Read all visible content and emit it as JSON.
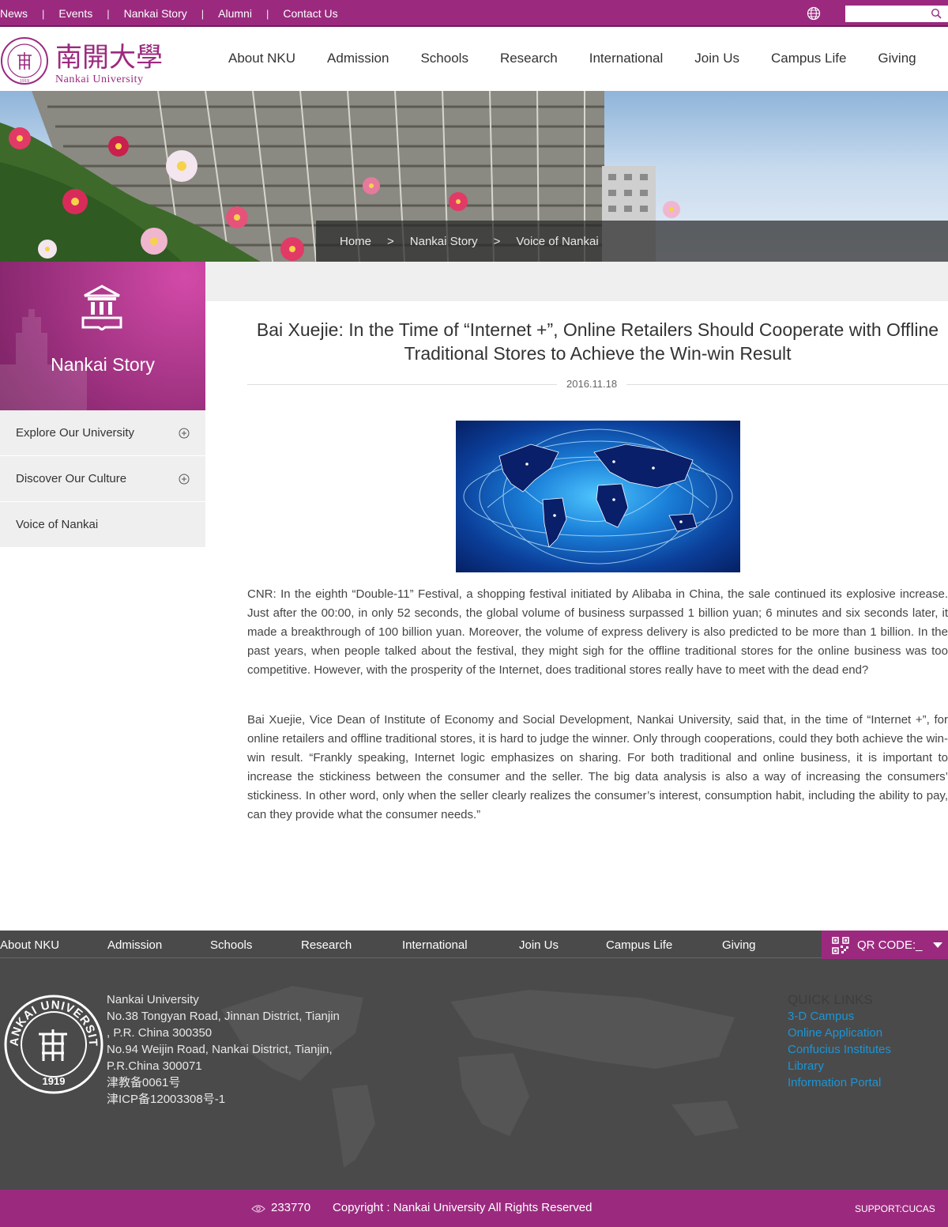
{
  "topbar": {
    "links": [
      "News",
      "Events",
      "Nankai Story",
      "Alumni",
      "Contact Us"
    ],
    "search_placeholder": ""
  },
  "header": {
    "logo_cn": "南開大學",
    "logo_en": "Nankai University",
    "nav": [
      "About NKU",
      "Admission",
      "Schools",
      "Research",
      "International",
      "Join Us",
      "Campus Life",
      "Giving"
    ]
  },
  "breadcrumb": [
    "Home",
    ">",
    "Nankai Story",
    ">",
    "Voice of Nankai"
  ],
  "sidebar": {
    "title": "Nankai Story",
    "items": [
      {
        "label": "Explore Our University"
      },
      {
        "label": "Discover Our Culture"
      },
      {
        "label": "Voice of Nankai"
      }
    ]
  },
  "article": {
    "title": "Bai Xuejie: In the Time of “Internet +”, Online Retailers Should Cooperate with Offline Traditional Stores to Achieve the Win-win Result",
    "date": "2016.11.18",
    "paragraphs": [
      "CNR: In the eighth “Double-11” Festival, a shopping festival initiated by Alibaba in China, the sale continued its explosive increase. Just after the 00:00, in only 52 seconds, the global volume of business surpassed 1 billion yuan; 6 minutes and six seconds later, it made a breakthrough of 100 billion yuan. Moreover, the volume of express delivery is also predicted to be more than 1 billion. In the past years, when people talked about the festival, they might sigh for the offline traditional stores for the online business was too competitive. However, with the prosperity of the Internet, does traditional stores really have to meet with the dead end?",
      "Bai Xuejie, Vice Dean of Institute of Economy and Social Development, Nankai University, said that, in the time of “Internet +”, for online retailers and offline traditional stores, it is hard to judge the winner. Only through cooperations, could they both achieve the win-win result. “Frankly speaking, Internet logic emphasizes on sharing. For both traditional and online business, it is important to increase the stickiness between the consumer and the seller. The big data analysis is also a way of increasing the consumers’ stickiness. In other word, only when the seller clearly realizes the consumer’s interest, consumption habit, including the ability to pay, can they provide what the consumer needs.”"
    ]
  },
  "footer": {
    "nav": [
      "About NKU",
      "Admission",
      "Schools",
      "Research",
      "International",
      "Join Us",
      "Campus Life",
      "Giving"
    ],
    "qr_label": "QR CODE:_",
    "address": [
      "Nankai University",
      "No.38 Tongyan Road, Jinnan District, Tianjin",
      ", P.R. China 300350",
      "No.94 Weijin Road,  Nankai District, Tianjin,",
      "P.R.China  300071",
      "津教备0061号",
      "津ICP备12003308号-1"
    ],
    "quick_links_heading": "QUICK LINKS",
    "quick_links": [
      "3-D Campus",
      "Online Application",
      "Confucius Institutes",
      "Library",
      "Information Portal"
    ],
    "seal_text": "NANKAI UNIVERSITY",
    "seal_year": "1919"
  },
  "bottombar": {
    "visits": "233770",
    "copyright": "Copyright : Nankai University All Rights Reserved",
    "support": "SUPPORT:CUCAS"
  },
  "colors": {
    "brand": "#9b2a7f",
    "footer_bg": "#4a4a4a",
    "link": "#1b95d6"
  }
}
